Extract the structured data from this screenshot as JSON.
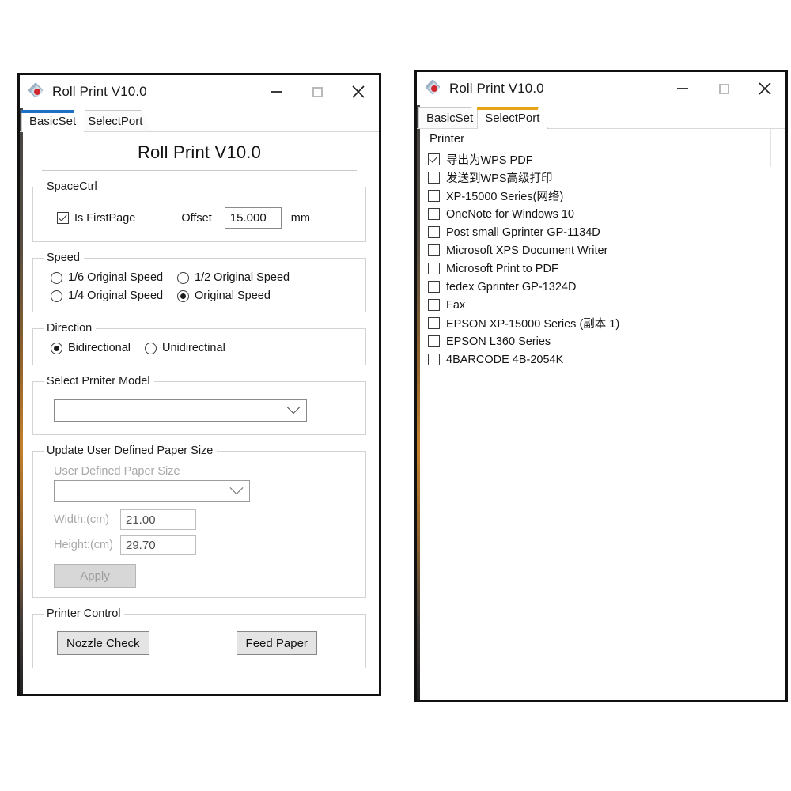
{
  "app": {
    "title": "Roll Print V10.0",
    "icon": "diamond-app-icon",
    "accent_blue": "#1f6fc4",
    "accent_orange": "#e8a317"
  },
  "caption": {
    "minimize": "minimize-icon",
    "maximize": "maximize-icon",
    "close": "close-icon"
  },
  "left_window": {
    "title": "Roll Print V10.0",
    "tabs": [
      {
        "label": "BasicSet",
        "active": true
      },
      {
        "label": "SelectPort",
        "active": false
      }
    ],
    "hero_title": "Roll Print V10.0",
    "space_ctrl": {
      "legend": "SpaceCtrl",
      "is_first_page_label": "Is FirstPage",
      "is_first_page_checked": true,
      "offset_label": "Offset",
      "offset_value": "15.000",
      "offset_unit": "mm"
    },
    "speed": {
      "legend": "Speed",
      "options": [
        {
          "label": "1/6 Original Speed",
          "selected": false
        },
        {
          "label": "1/2 Original Speed",
          "selected": false
        },
        {
          "label": "1/4 Original Speed",
          "selected": false
        },
        {
          "label": "Original Speed",
          "selected": true
        }
      ]
    },
    "direction": {
      "legend": "Direction",
      "options": [
        {
          "label": "Bidirectional",
          "selected": true
        },
        {
          "label": "Unidirectinal",
          "selected": false
        }
      ]
    },
    "printer_model": {
      "legend": "Select Prniter Model",
      "selected": ""
    },
    "paper_size": {
      "legend": "Update User Defined Paper Size",
      "sub_label": "User Defined Paper Size",
      "selected": "",
      "width_label": "Width:(cm)",
      "width_value": "21.00",
      "height_label": "Height:(cm)",
      "height_value": "29.70",
      "apply_label": "Apply"
    },
    "printer_control": {
      "legend": "Printer Control",
      "nozzle_check_label": "Nozzle Check",
      "feed_paper_label": "Feed Paper"
    }
  },
  "right_window": {
    "title": "Roll Print V10.0",
    "tabs": [
      {
        "label": "BasicSet",
        "active": false
      },
      {
        "label": "SelectPort",
        "active": true
      }
    ],
    "printer_section_label": "Printer",
    "printers": [
      {
        "label": "导出为WPS PDF",
        "checked": true
      },
      {
        "label": "发送到WPS高级打印",
        "checked": false
      },
      {
        "label": "XP-15000 Series(网络)",
        "checked": false
      },
      {
        "label": "OneNote for Windows 10",
        "checked": false
      },
      {
        "label": "Post small Gprinter  GP-1134D",
        "checked": false
      },
      {
        "label": "Microsoft XPS Document Writer",
        "checked": false
      },
      {
        "label": "Microsoft Print to PDF",
        "checked": false
      },
      {
        "label": "fedex Gprinter  GP-1324D",
        "checked": false
      },
      {
        "label": "Fax",
        "checked": false
      },
      {
        "label": "EPSON XP-15000 Series (副本 1)",
        "checked": false
      },
      {
        "label": "EPSON L360 Series",
        "checked": false
      },
      {
        "label": "4BARCODE 4B-2054K",
        "checked": false
      }
    ]
  }
}
